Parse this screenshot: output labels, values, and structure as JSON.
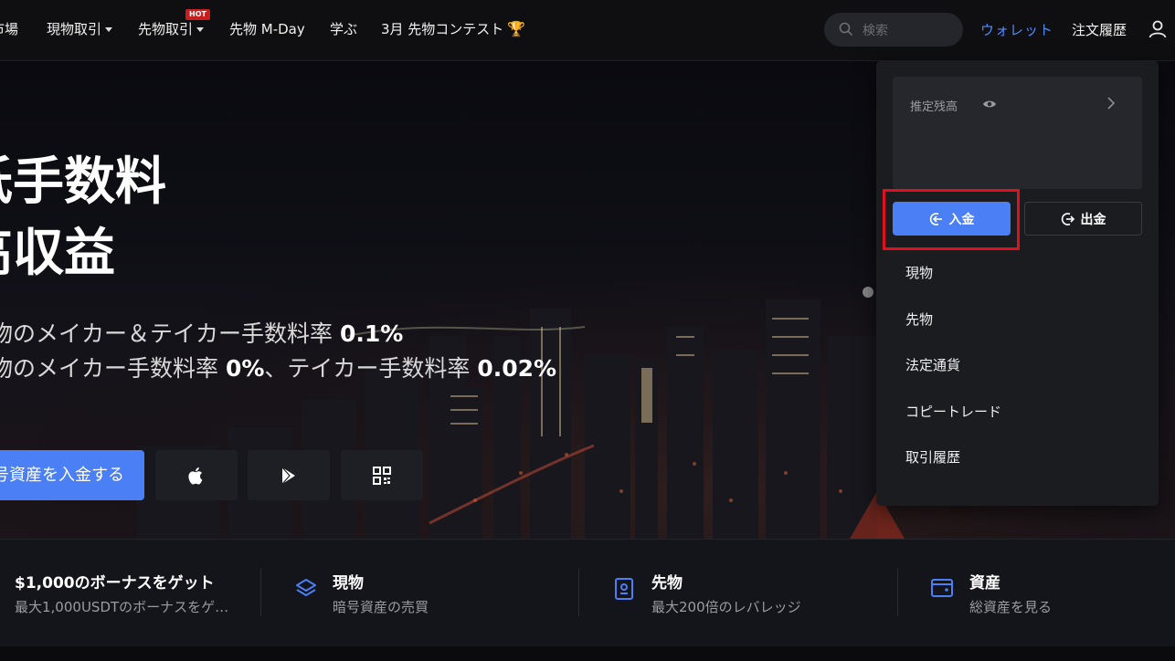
{
  "nav": {
    "market": "市場",
    "spot": "現物取引",
    "futures": "先物取引",
    "hot_badge": "HOT",
    "mday": "先物 M-Day",
    "learn": "学ぶ",
    "contest": "3月 先物コンテスト",
    "search_placeholder": "検索",
    "wallet": "ウォレット",
    "orders": "注文履歴"
  },
  "hero": {
    "title_line1": "低手数料",
    "title_line2": "高収益",
    "sub1_text": "現物のメイカー＆テイカー手数料率 ",
    "sub1_value": "0.1%",
    "sub2_text": "先物のメイカー手数料率 ",
    "sub2_value1": "0%",
    "sub2_mid": "、テイカー手数料率 ",
    "sub2_value2": "0.02%",
    "cta": "暗号資産を入金する"
  },
  "features": [
    {
      "title": "$1,000のボーナスをゲット",
      "desc": "最大1,000USDTのボーナスをゲ…"
    },
    {
      "title": "現物",
      "desc": "暗号資産の売買"
    },
    {
      "title": "先物",
      "desc": "最大200倍のレバレッジ"
    },
    {
      "title": "資産",
      "desc": "総資産を見る"
    }
  ],
  "wallet_menu": {
    "balance_label": "推定残高",
    "deposit": "入金",
    "withdraw": "出金",
    "items": [
      "現物",
      "先物",
      "法定通貨",
      "コピートレード",
      "取引履歴"
    ]
  },
  "colors": {
    "accent": "#4a7ff5",
    "highlight": "#e0101c",
    "hot": "#c81e1e"
  },
  "icons": [
    "search-icon",
    "user-icon",
    "trophy-icon",
    "eye-icon",
    "chevron-right-icon",
    "deposit-icon",
    "withdraw-icon",
    "apple-icon",
    "google-play-icon",
    "qr-code-icon",
    "layers-icon",
    "document-icon",
    "wallet-icon"
  ]
}
